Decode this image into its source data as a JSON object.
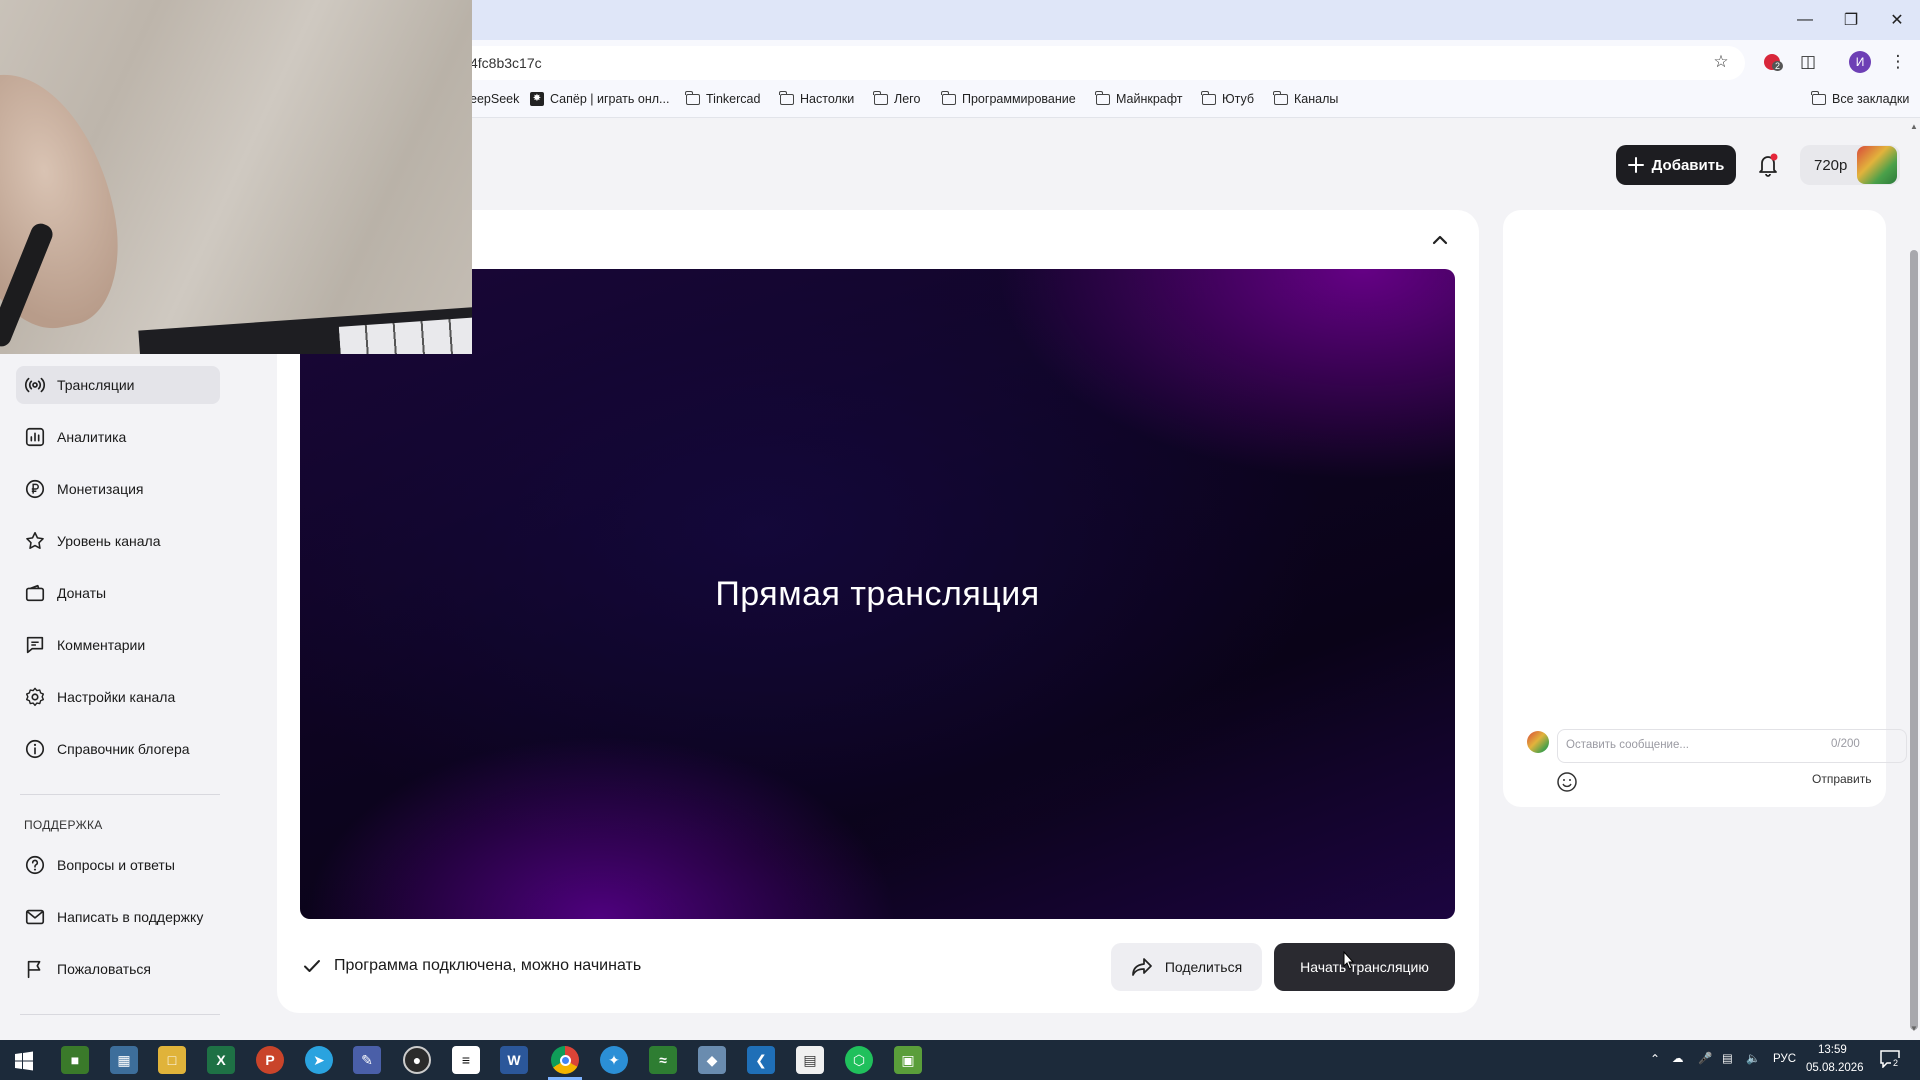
{
  "browser": {
    "url_fragment": "4fc8b3c17c",
    "profile_initial": "И",
    "badge_count": "2",
    "bookmarks": [
      {
        "label": "eepSeek",
        "icon": "none"
      },
      {
        "label": "Сапёр | играть онл...",
        "icon": "minesweeper-icon"
      },
      {
        "label": "Tinkercad",
        "icon": "folder-icon"
      },
      {
        "label": "Настолки",
        "icon": "folder-icon"
      },
      {
        "label": "Лего",
        "icon": "folder-icon"
      },
      {
        "label": "Программирование",
        "icon": "folder-icon"
      },
      {
        "label": "Майнкрафт",
        "icon": "folder-icon"
      },
      {
        "label": "Ютуб",
        "icon": "folder-icon"
      },
      {
        "label": "Каналы",
        "icon": "folder-icon"
      }
    ],
    "all_bookmarks": "Все закладки"
  },
  "header": {
    "add_label": "Добавить",
    "quality": "720p"
  },
  "sidebar": {
    "items": [
      {
        "label": "Трансляции",
        "icon": "broadcast-icon",
        "active": true
      },
      {
        "label": "Аналитика",
        "icon": "analytics-icon"
      },
      {
        "label": "Монетизация",
        "icon": "ruble-icon"
      },
      {
        "label": "Уровень канала",
        "icon": "star-icon"
      },
      {
        "label": "Донаты",
        "icon": "wallet-icon"
      },
      {
        "label": "Комментарии",
        "icon": "comment-icon"
      },
      {
        "label": "Настройки канала",
        "icon": "gear-icon"
      },
      {
        "label": "Справочник блогера",
        "icon": "info-icon"
      }
    ],
    "support_heading": "ПОДДЕРЖКА",
    "support_items": [
      {
        "label": "Вопросы и ответы",
        "icon": "question-icon"
      },
      {
        "label": "Написать в поддержку",
        "icon": "mail-icon"
      },
      {
        "label": "Пожаловаться",
        "icon": "flag-icon"
      }
    ]
  },
  "stream": {
    "player_title": "Прямая трансляция",
    "status_text": "Программа подключена, можно начинать",
    "share_label": "Поделиться",
    "start_label": "Начать трансляцию"
  },
  "chat": {
    "placeholder": "Оставить сообщение...",
    "counter": "0/200",
    "send_label": "Отправить"
  },
  "taskbar": {
    "language": "РУС",
    "time": "13:59",
    "date": "05.08.2026",
    "notifications": "2"
  },
  "colors": {
    "accent_dark": "#1d1d21",
    "player_purple": "#6c00aa"
  }
}
